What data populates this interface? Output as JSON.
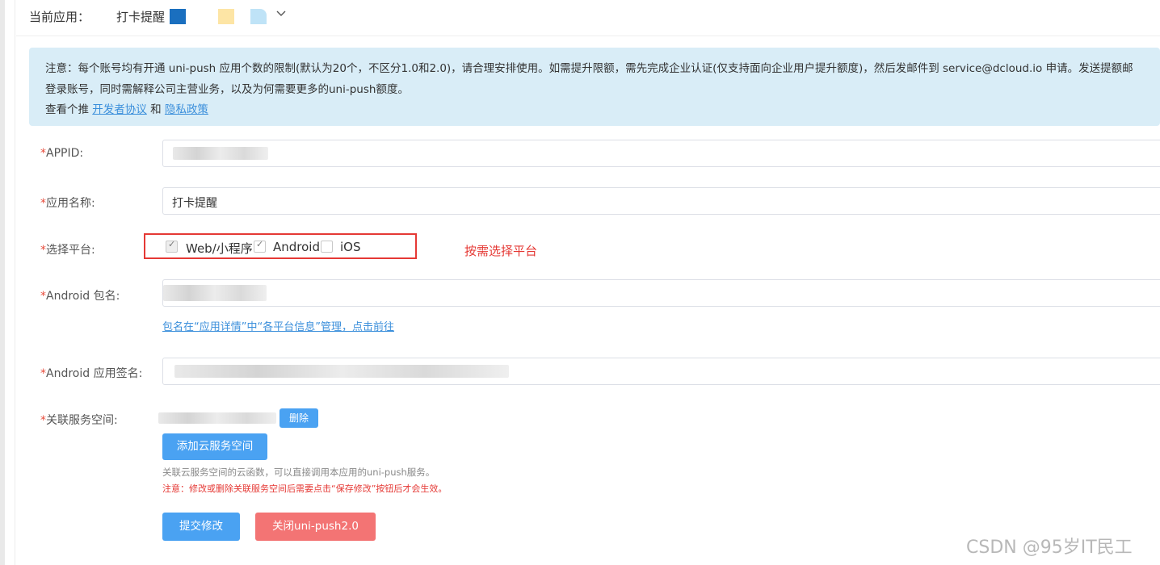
{
  "header": {
    "current_app_label": "当前应用：",
    "app_name": "打卡提醒",
    "swatch_colors": [
      "#1a6fbf",
      "#fde5a5",
      "#bfe3f7"
    ]
  },
  "notice": {
    "line1": "注意：每个账号均有开通 uni-push 应用个数的限制(默认为20个，不区分1.0和2.0)，请合理安排使用。如需提升限额，需先完成企业认证(仅支持面向企业用户提升额度)，然后发邮件到 service@dcloud.io 申请。发送提额邮",
    "line2": "登录账号，同时需解释公司主营业务，以及为何需要更多的uni-push额度。",
    "line3_prefix": "查看个推",
    "dev_agreement": "开发者协议",
    "and": "和",
    "privacy_policy": "隐私政策"
  },
  "form": {
    "appid_label": "APPID:",
    "app_name_label": "应用名称:",
    "app_name_value": "打卡提醒",
    "platform_label": "选择平台:",
    "platforms": [
      {
        "label": "Web/小程序",
        "checked": true,
        "disabled": true
      },
      {
        "label": "Android",
        "checked": true,
        "disabled": false
      },
      {
        "label": "iOS",
        "checked": false,
        "disabled": false
      }
    ],
    "platform_annotation": "按需选择平台",
    "android_pkg_label": "Android 包名:",
    "android_pkg_link": "包名在“应用详情”中“各平台信息”管理，点击前往",
    "android_sig_label": "Android 应用签名:",
    "cloud_space_label": "关联服务空间:",
    "delete_button": "删除",
    "add_cloud_button": "添加云服务空间",
    "cloud_hint": "关联云服务空间的云函数，可以直接调用本应用的uni-push服务。",
    "cloud_warning": "注意：修改或删除关联服务空间后需要点击“保存修改”按钮后才会生效。",
    "submit_button": "提交修改",
    "close_button": "关闭uni-push2.0",
    "required_mark": "*"
  },
  "watermark": "CSDN @95岁IT民工"
}
